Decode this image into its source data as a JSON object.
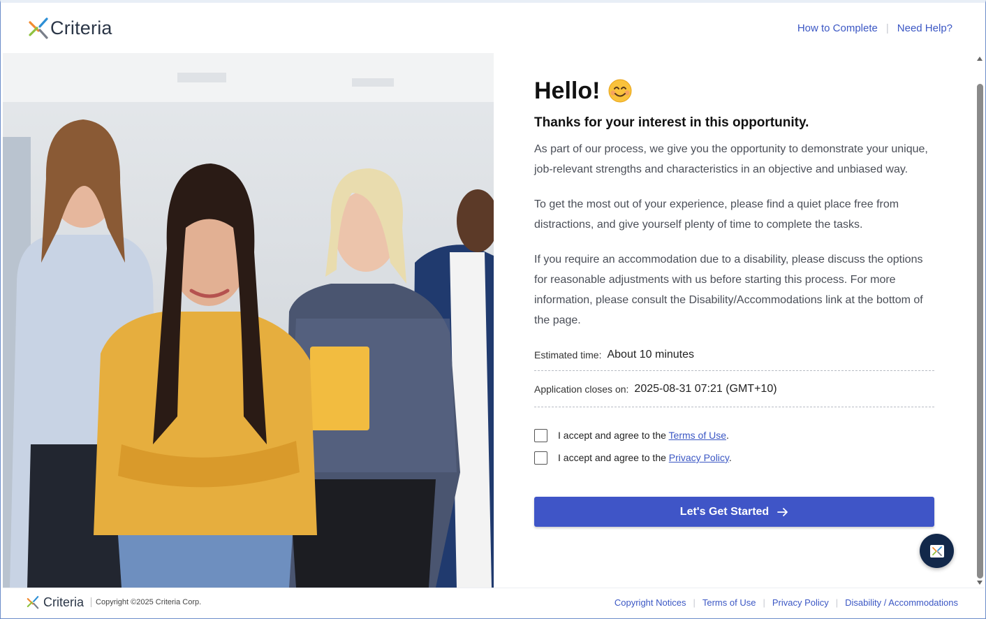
{
  "header": {
    "logo_text": "Criteria",
    "links": [
      "How to Complete",
      "Need Help?"
    ]
  },
  "hero": {
    "image_icon": "team-photo"
  },
  "main": {
    "greeting": "Hello!",
    "greeting_icon": "smiling-face-icon",
    "subtitle": "Thanks for your interest in this opportunity.",
    "paragraphs": [
      "As part of our process, we give you the opportunity to demonstrate your unique, job-relevant strengths and characteristics in an objective and unbiased way.",
      "To get the most out of your experience, please find a quiet place free from distractions, and give yourself plenty of time to complete the tasks.",
      "If you require an accommodation due to a disability, please discuss the options for reasonable adjustments with us before starting this process. For more information, please consult the Disability/Accommodations link at the bottom of the page."
    ],
    "estimated_time_label": "Estimated time:",
    "estimated_time_value": "About 10 minutes",
    "closes_label": "Application closes on:",
    "closes_value": "2025-08-31 07:21 (GMT+10)",
    "terms_prefix": "I accept and agree to the",
    "terms_link": "Terms of Use",
    "privacy_prefix": "I accept and agree to the",
    "privacy_link": "Privacy Policy",
    "period": ".",
    "cta_label": "Let's Get Started",
    "cta_icon": "arrow-right-icon"
  },
  "colors": {
    "accent": "#3f55c7",
    "link": "#3b57c4",
    "chat_bubble": "#12284a"
  },
  "footer": {
    "logo_text": "Criteria",
    "copyright": "Copyright ©2025 Criteria Corp.",
    "links": [
      "Copyright Notices",
      "Terms of Use",
      "Privacy Policy",
      "Disability / Accommodations"
    ]
  }
}
